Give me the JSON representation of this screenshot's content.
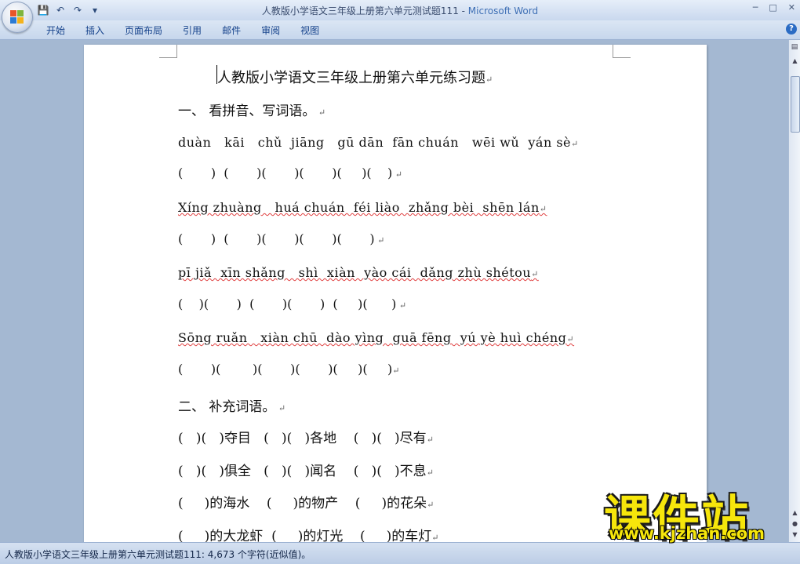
{
  "window": {
    "doc_name": "人教版小学语文三年级上册第六单元测试题111",
    "separator": " - ",
    "app_name": "Microsoft Word"
  },
  "ribbon_tabs": [
    "开始",
    "插入",
    "页面布局",
    "引用",
    "邮件",
    "审阅",
    "视图"
  ],
  "document": {
    "title": "人教版小学语文三年级上册第六单元练习题",
    "section1": "一、 看拼音、写词语。",
    "pinyin_rows": [
      "duàn   kāi   chǔ  jiāng   gū dān  fān chuán   wēi wǔ  yán sè",
      "Xíng zhuàng   huá chuán  féi liào  zhǎng bèi  shēn lán",
      "pī jiǎ  xīn shǎng   shì  xiàn  yào cái  dǎng zhù shétou",
      "Sōng ruǎn   xiàn chū  dào yìng  guā fēng  yú yè huì chéng"
    ],
    "paren_rows": [
      "(       )  (       )(       )(       )(     )(    )",
      "(       )  (       )(       )(       )(       )",
      "(    )(       )  (       )(       )  (     )(      )",
      "(       )(        )(       )(       )(     )(     )"
    ],
    "section2": "二、 补充词语。",
    "fill_rows": [
      "(   )(   )夺目   (   )(   )各地    (   )(   )尽有",
      "(   )(   )俱全   (   )(   )闻名    (   )(   )不息",
      "(     )的海水    (     )的物产    (     )的花朵",
      "(     )的大龙虾  (     )的灯光    (     )的车灯"
    ]
  },
  "status": {
    "text": "人教版小学语文三年级上册第六单元测试题111: 4,673 个字符(近似值)。"
  },
  "watermark": {
    "brand": "课件站",
    "url": "www.kjzhan.com"
  }
}
